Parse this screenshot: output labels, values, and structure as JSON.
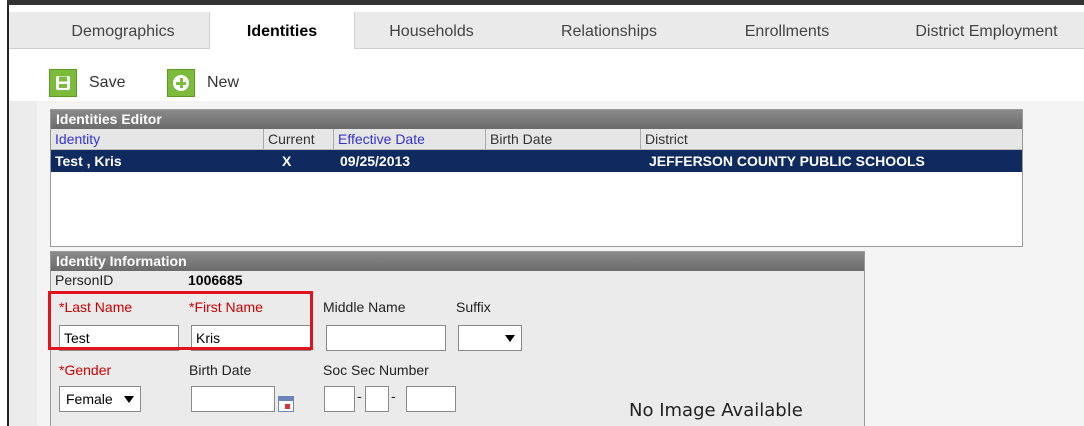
{
  "tabs": [
    {
      "label": "Demographics"
    },
    {
      "label": "Identities"
    },
    {
      "label": "Households"
    },
    {
      "label": "Relationships"
    },
    {
      "label": "Enrollments"
    },
    {
      "label": "District Employment"
    }
  ],
  "toolbar": {
    "save_label": "Save",
    "new_label": "New"
  },
  "editor": {
    "title": "Identities Editor",
    "columns": [
      "Identity",
      "Current",
      "Effective Date",
      "Birth Date",
      "District"
    ],
    "rows": [
      {
        "identity": "Test , Kris",
        "current": "X",
        "effective_date": "09/25/2013",
        "birth_date": "",
        "district": "JEFFERSON COUNTY PUBLIC SCHOOLS"
      }
    ]
  },
  "info": {
    "title": "Identity Information",
    "person_id_label": "PersonID",
    "person_id": "1006685",
    "last_name_label": "*Last Name",
    "first_name_label": "*First Name",
    "middle_name_label": "Middle Name",
    "suffix_label": "Suffix",
    "last_name": "Test",
    "first_name": "Kris",
    "middle_name": "",
    "suffix": "",
    "gender_label": "*Gender",
    "birth_date_label": "Birth Date",
    "ssn_label": "Soc Sec Number",
    "gender": "Female",
    "birth_date": "",
    "no_image": "No Image Available"
  },
  "colors": {
    "selected_row": "#0f2a5f",
    "required_label": "#cc0000",
    "highlight": "#e0141e",
    "toolbar_icon": "#7dbb3c"
  }
}
